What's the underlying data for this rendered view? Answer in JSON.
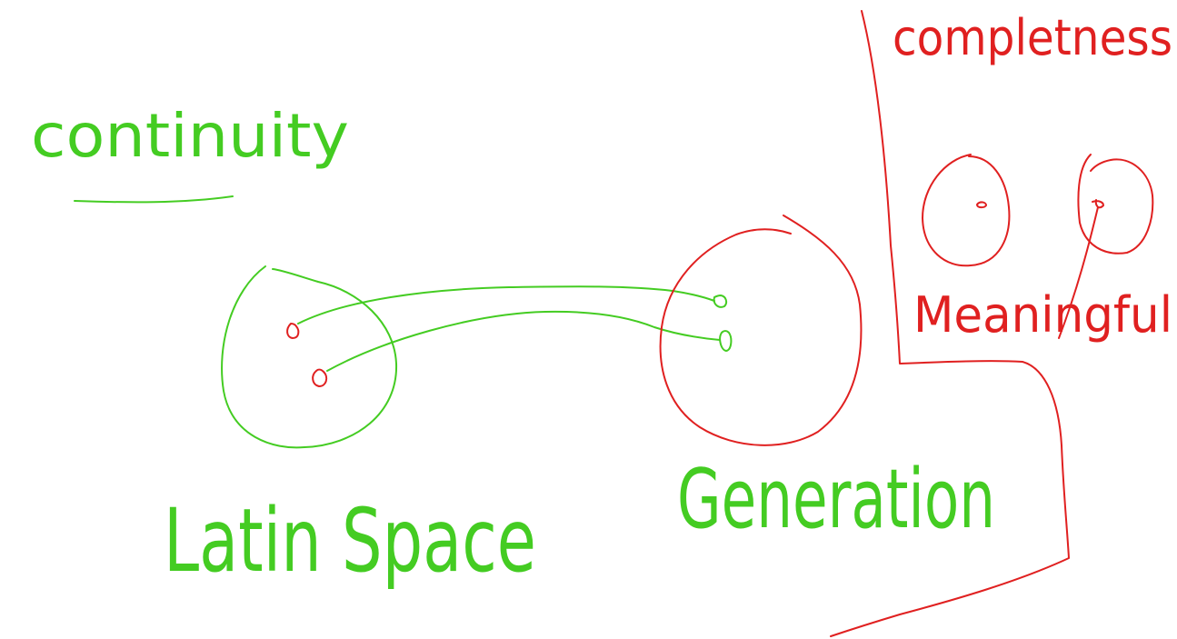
{
  "labels": {
    "continuity": "continuity",
    "latent_space": "Latin Space",
    "generation": "Generation",
    "completeness": "completness",
    "meaningful": "Meaningful"
  },
  "colors": {
    "green": "#44cc22",
    "red": "#e02020",
    "background": "#ffffff"
  }
}
